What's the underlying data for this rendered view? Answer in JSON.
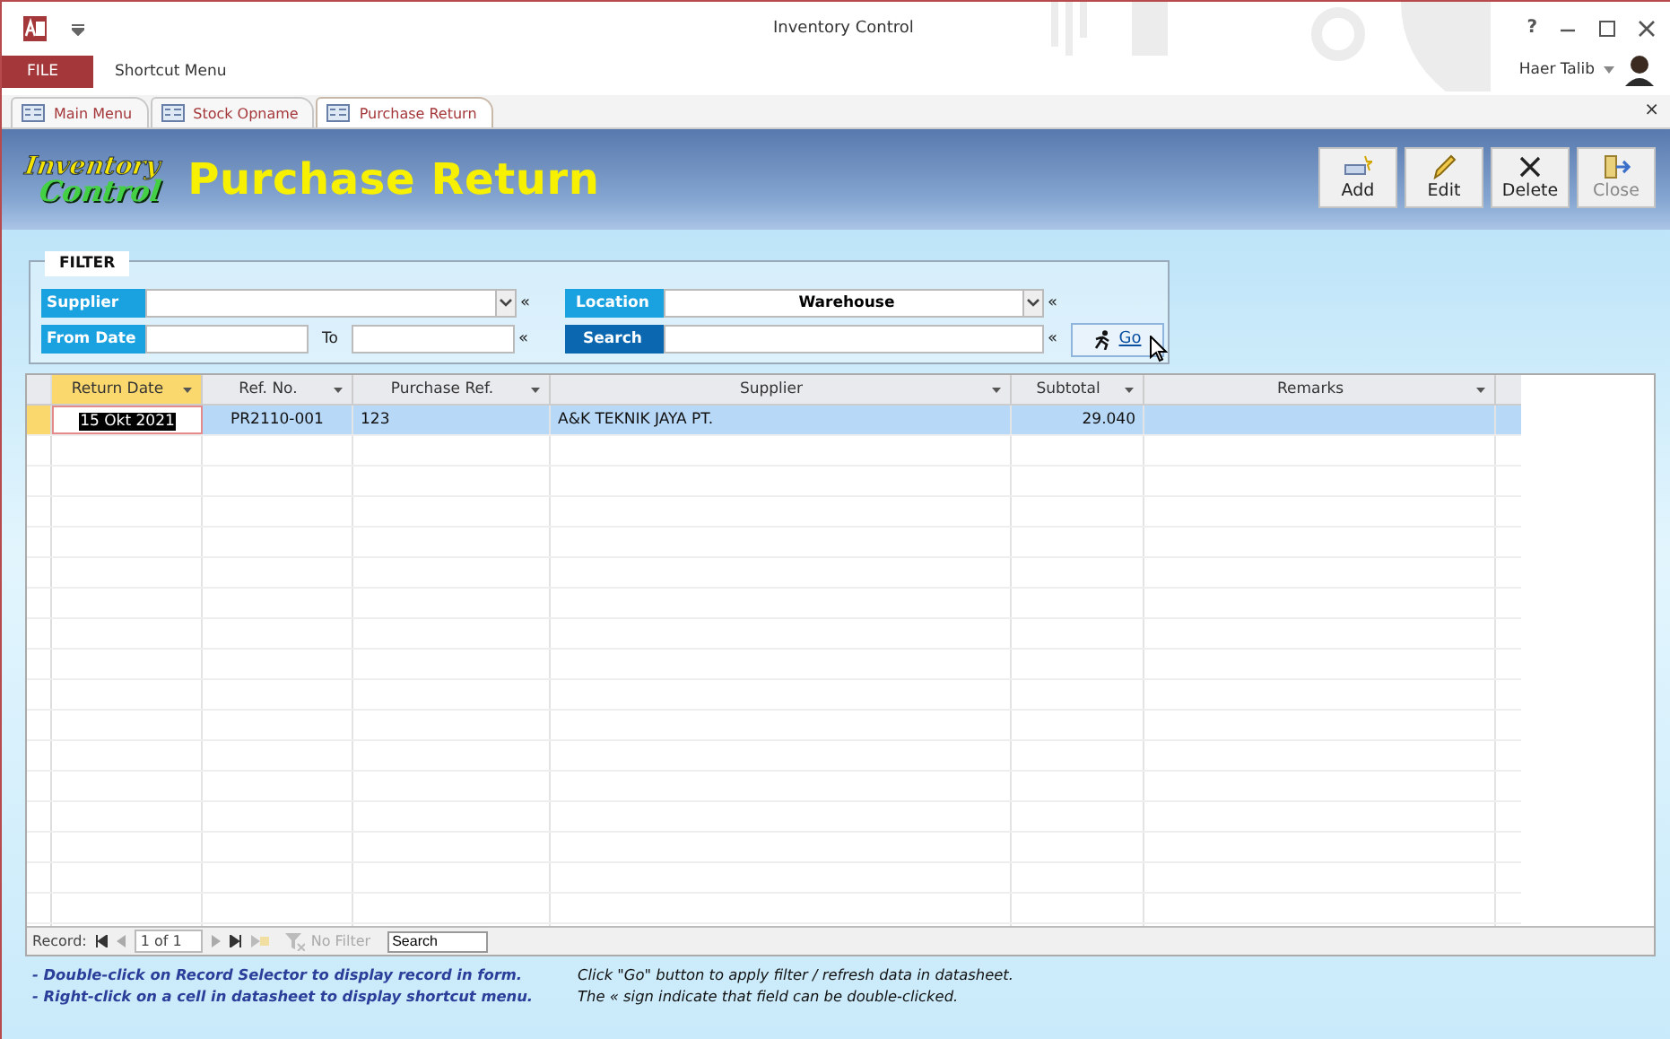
{
  "window": {
    "title": "Inventory Control",
    "help": "?",
    "user": "Haer Talib"
  },
  "menu": [
    {
      "label": "FILE",
      "kind": "file"
    },
    {
      "label": "Shortcut Menu",
      "kind": "plain"
    }
  ],
  "tabs": [
    {
      "label": "Main Menu",
      "selected": false
    },
    {
      "label": "Stock Opname",
      "selected": false
    },
    {
      "label": "Purchase Return",
      "selected": true
    }
  ],
  "tab_close": "×",
  "header": {
    "logo": [
      "Inventory",
      "Control"
    ],
    "title": "Purchase Return"
  },
  "toolbar": [
    {
      "label": "Add",
      "kind": "add",
      "disabled": false
    },
    {
      "label": "Edit",
      "kind": "edit",
      "disabled": false
    },
    {
      "label": "Delete",
      "kind": "delete",
      "disabled": false
    },
    {
      "label": "Close",
      "kind": "close",
      "disabled": true
    }
  ],
  "filter": {
    "title": "FILTER",
    "supplier": {
      "label": "Supplier",
      "marker": "«"
    },
    "from_date": {
      "label": "From Date"
    },
    "to": {
      "label": "To",
      "marker": "«"
    },
    "location": {
      "label": "Location",
      "value": "Warehouse",
      "marker": "«"
    },
    "search": {
      "label": "Search",
      "marker": "«"
    },
    "go": "Go"
  },
  "table": {
    "columns": [
      {
        "label": "Return Date",
        "sorted": true
      },
      {
        "label": "Ref. No.",
        "sorted": false
      },
      {
        "label": "Purchase Ref.",
        "sorted": false
      },
      {
        "label": "Supplier",
        "sorted": false
      },
      {
        "label": "Subtotal",
        "sorted": false
      },
      {
        "label": "Remarks",
        "sorted": false
      }
    ],
    "rows": [
      {
        "selected": true,
        "cells": [
          "15 Okt 2021",
          "PR2110-001",
          "123",
          "A&K TEKNIK JAYA PT.",
          "29.040",
          ""
        ]
      }
    ]
  },
  "navigator": {
    "label": "Record:",
    "position": "1 of 1",
    "filter": "No Filter",
    "search_placeholder": "Search"
  },
  "notes_left": [
    "- Double-click on Record Selector to display record in form.",
    "- Right-click on a cell in datasheet to display shortcut menu."
  ],
  "notes_right": [
    "Click \"Go\" button to apply filter / refresh data in datasheet.",
    "The « sign indicate that field can be double-clicked."
  ]
}
